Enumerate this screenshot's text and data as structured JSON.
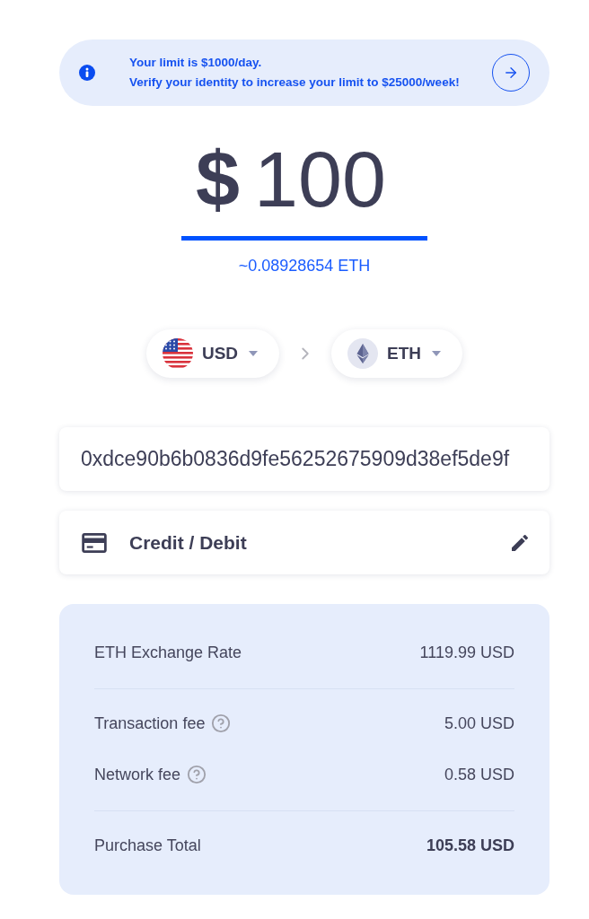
{
  "banner": {
    "lines": [
      "Your limit is $1000/day.",
      "Verify your identity to increase your limit to $25000/week!"
    ]
  },
  "amount": {
    "currency_symbol": "$",
    "value": "100",
    "conversion": "~0.08928654 ETH"
  },
  "currency_pair": [
    {
      "kind": "fiat",
      "code": "USD"
    },
    {
      "kind": "crypto",
      "code": "ETH"
    }
  ],
  "wallet_address": {
    "value": "0xdce90b6b0836d9fe56252675909d38ef5de9f"
  },
  "payment_method": {
    "label": "Credit / Debit"
  },
  "summary": {
    "groups": [
      [
        {
          "label": "ETH Exchange Rate",
          "value": "1119.99 USD",
          "help": false,
          "bold": false
        }
      ],
      [
        {
          "label": "Transaction fee",
          "value": "5.00 USD",
          "help": true,
          "bold": false
        },
        {
          "label": "Network fee",
          "value": "0.58 USD",
          "help": true,
          "bold": false
        }
      ],
      [
        {
          "label": "Purchase Total",
          "value": "105.58 USD",
          "help": false,
          "bold": true
        }
      ]
    ]
  }
}
